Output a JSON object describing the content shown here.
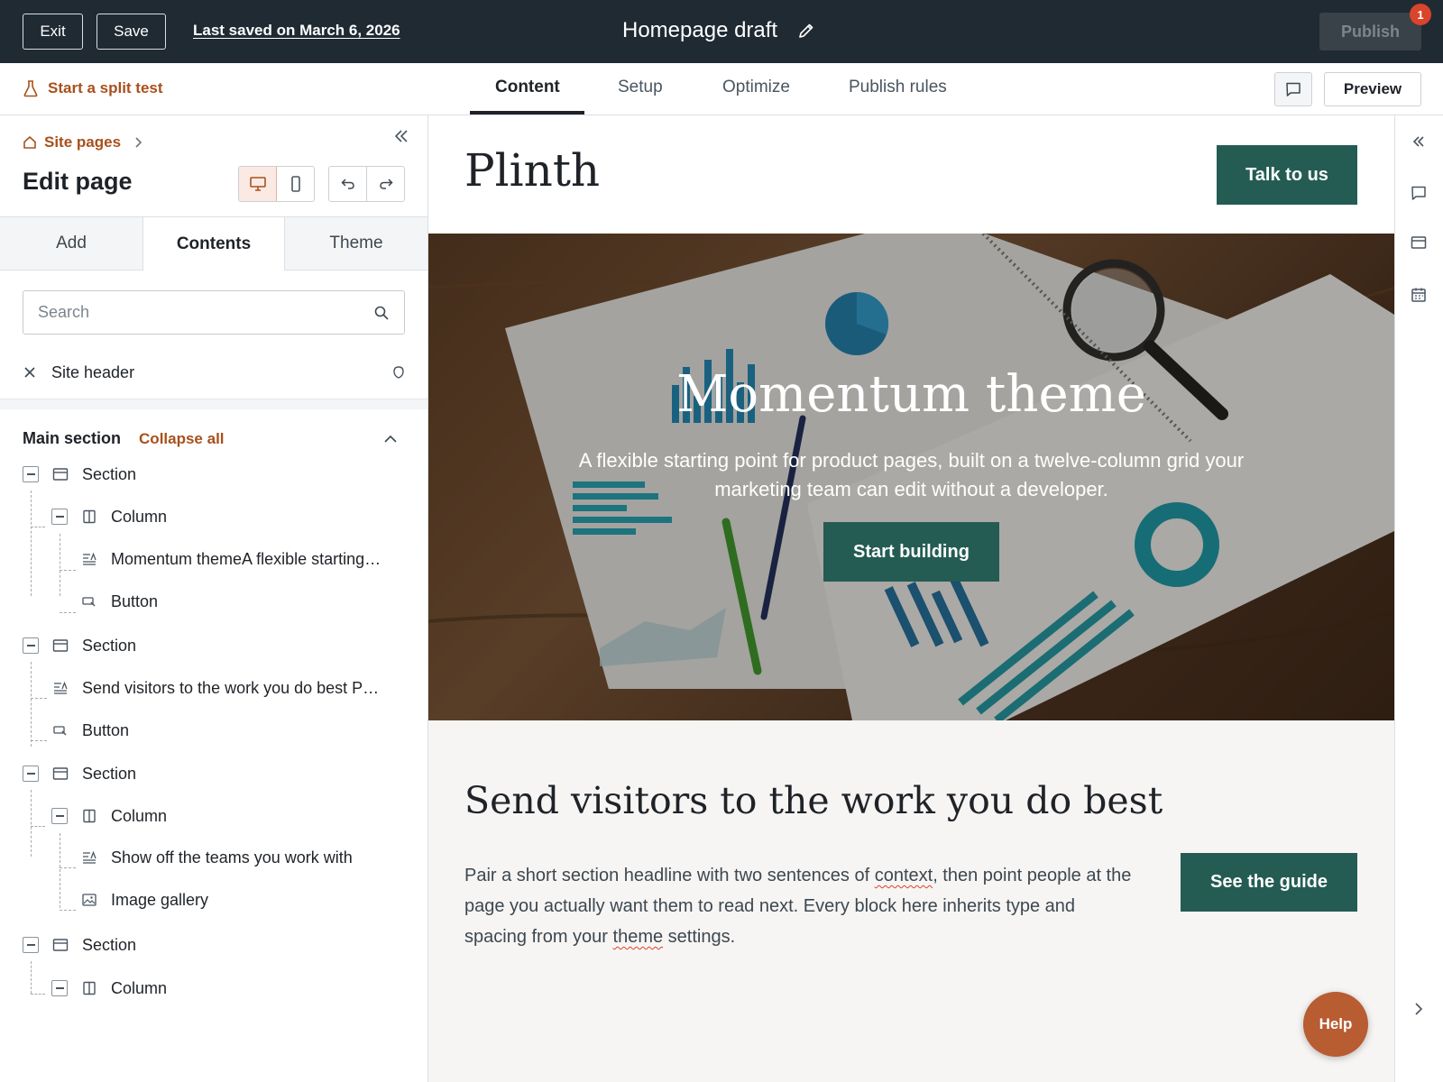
{
  "topbar": {
    "exit_label": "Exit",
    "save_label": "Save",
    "last_saved": "Last saved on March 6, 2026",
    "title": "Homepage draft",
    "publish_label": "Publish",
    "publish_badge": "1"
  },
  "subbar": {
    "split_test": "Start a split test",
    "tabs": [
      {
        "label": "Content",
        "active": true
      },
      {
        "label": "Setup",
        "active": false
      },
      {
        "label": "Optimize",
        "active": false
      },
      {
        "label": "Publish rules",
        "active": false
      }
    ],
    "preview_label": "Preview"
  },
  "left_panel": {
    "breadcrumb": "Site pages",
    "title": "Edit page",
    "tabs": [
      {
        "label": "Add",
        "active": false
      },
      {
        "label": "Contents",
        "active": true
      },
      {
        "label": "Theme",
        "active": false
      }
    ],
    "search_placeholder": "Search",
    "site_header": "Site header",
    "main_section": "Main section",
    "collapse_all": "Collapse all",
    "tree": [
      {
        "label": "Section",
        "icon": "section-icon"
      },
      {
        "label": "Column",
        "icon": "column-icon"
      },
      {
        "label": "Momentum themeA flexible starting…",
        "icon": "rich-text-icon"
      },
      {
        "label": "Button",
        "icon": "button-icon"
      },
      {
        "label": "Section",
        "icon": "section-icon"
      },
      {
        "label": "Send visitors to the work you do best P…",
        "icon": "rich-text-icon"
      },
      {
        "label": "Button",
        "icon": "button-icon"
      },
      {
        "label": "Section",
        "icon": "section-icon"
      },
      {
        "label": "Column",
        "icon": "column-icon"
      },
      {
        "label": "Show off the teams you work with",
        "icon": "rich-text-icon"
      },
      {
        "label": "Image gallery",
        "icon": "image-icon"
      },
      {
        "label": "Section",
        "icon": "section-icon"
      },
      {
        "label": "Column",
        "icon": "column-icon"
      }
    ]
  },
  "canvas": {
    "logo": "Plinth",
    "talk_button": "Talk to us",
    "hero_title": "Momentum theme",
    "hero_subtitle": "A flexible starting point for product pages, built on a twelve-column grid your marketing team can edit without a developer.",
    "hero_button": "Start building",
    "section2_title": "Send visitors to the work you do best",
    "section2_body_1": "Pair a short section headline with two sentences of ",
    "section2_body_word1": "context",
    "section2_body_2": ", then point people at the page you actually want them to read next. Every block here inherits type and spacing from your ",
    "section2_body_word2": "theme",
    "section2_body_3": " settings.",
    "guide_button": "See the guide",
    "help_button": "Help"
  },
  "colors": {
    "topbar_bg": "#1f2a33",
    "accent_orange": "#a8501d",
    "brand_green": "#245c54",
    "help_orange": "#b85c31",
    "badge_red": "#d9442b"
  }
}
